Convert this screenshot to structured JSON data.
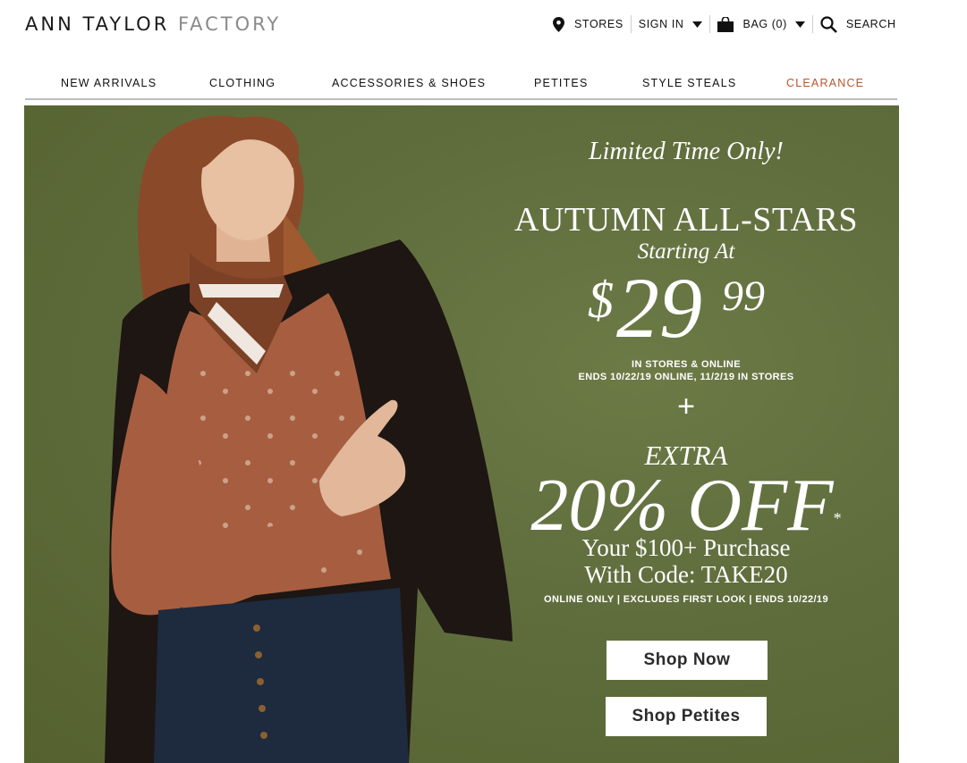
{
  "brand": {
    "logo_primary": "ANN TAYLOR",
    "logo_secondary": "FACTORY"
  },
  "utility": {
    "stores": "STORES",
    "sign_in": "SIGN IN",
    "bag": "BAG (0)",
    "search": "SEARCH"
  },
  "icons": {
    "stores": "location-pin-icon",
    "sign_in_caret": "caret-down-icon",
    "bag": "shopping-bag-icon",
    "bag_caret": "caret-down-icon",
    "search": "magnifier-icon"
  },
  "nav": {
    "items": [
      {
        "label": "NEW ARRIVALS"
      },
      {
        "label": "CLOTHING"
      },
      {
        "label": "ACCESSORIES & SHOES"
      },
      {
        "label": "PETITES"
      },
      {
        "label": "STYLE STEALS"
      },
      {
        "label": "CLEARANCE"
      }
    ]
  },
  "hero": {
    "eyebrow": "Limited Time Only!",
    "headline": "AUTUMN ALL-STARS",
    "starting_at": "Starting At",
    "price_currency": "$",
    "price_dollars": "29",
    "price_cents": "99",
    "channel": "IN STORES & ONLINE",
    "ends": "ENDS 10/22/19 ONLINE, 11/2/19 IN STORES",
    "plus": "+",
    "extra": "EXTRA",
    "percent_off": "20% OFF",
    "asterisk": "*",
    "purchase_line1": "Your $100+ Purchase",
    "purchase_line2": "With Code: TAKE20",
    "fine_print": "ONLINE ONLY | EXCLUDES FIRST LOOK | ENDS 10/22/19",
    "shop_now": "Shop Now",
    "shop_petites": "Shop Petites"
  },
  "colors": {
    "hero_bg": "#5f6d3d",
    "clearance": "#b5562e",
    "text": "#111111"
  }
}
